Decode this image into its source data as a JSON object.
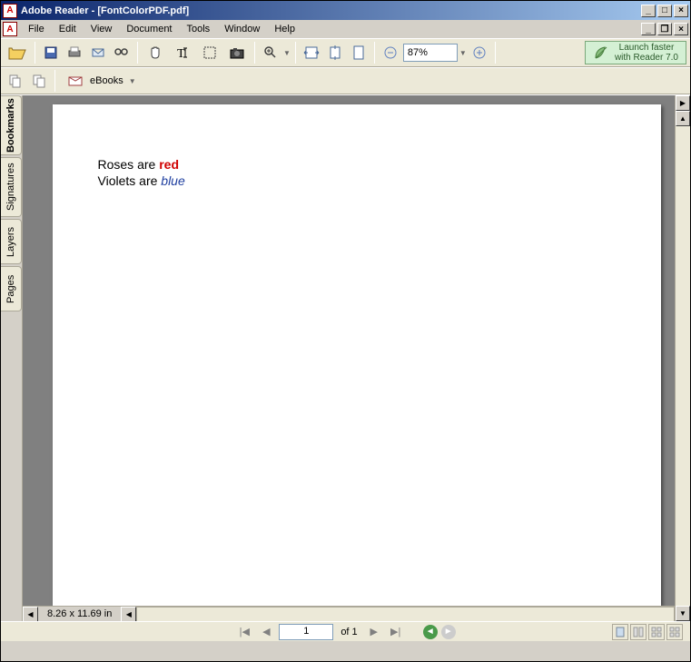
{
  "title": "Adobe Reader - [FontColorPDF.pdf]",
  "menus": [
    "File",
    "Edit",
    "View",
    "Document",
    "Tools",
    "Window",
    "Help"
  ],
  "zoom": "87%",
  "promo": {
    "line1": "Launch faster",
    "line2": "with Reader 7.0"
  },
  "ebooks": "eBooks",
  "sidetabs": {
    "bookmarks": "Bookmarks",
    "signatures": "Signatures",
    "layers": "Layers",
    "pages": "Pages"
  },
  "page": {
    "dimensions": "8.26 x 11.69 in",
    "current": "1",
    "of": "of 1"
  },
  "content": {
    "line1_a": "Roses are ",
    "line1_b": "red",
    "line2_a": "Violets are ",
    "line2_b": "blue"
  }
}
